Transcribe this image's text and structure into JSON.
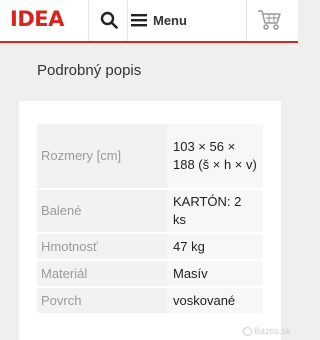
{
  "header": {
    "logo_text": "IDEA",
    "brand_color": "#d9231d",
    "search_icon": "search-icon",
    "menu_icon": "hamburger-icon",
    "menu_label": "Menu",
    "cart_icon": "cart-icon"
  },
  "section": {
    "title": "Podrobný popis"
  },
  "specs": [
    {
      "label": "Rozmery [cm]",
      "value": "103 × 56 × 188 (š × h × v)"
    },
    {
      "label": "Balené",
      "value": "KARTÓN: 2 ks"
    },
    {
      "label": "Hmotnosť",
      "value": "47 kg"
    },
    {
      "label": "Materiál",
      "value": "Masív"
    },
    {
      "label": "Povrch",
      "value": "voskované"
    }
  ],
  "watermark": {
    "text": "Bazos.sk"
  }
}
